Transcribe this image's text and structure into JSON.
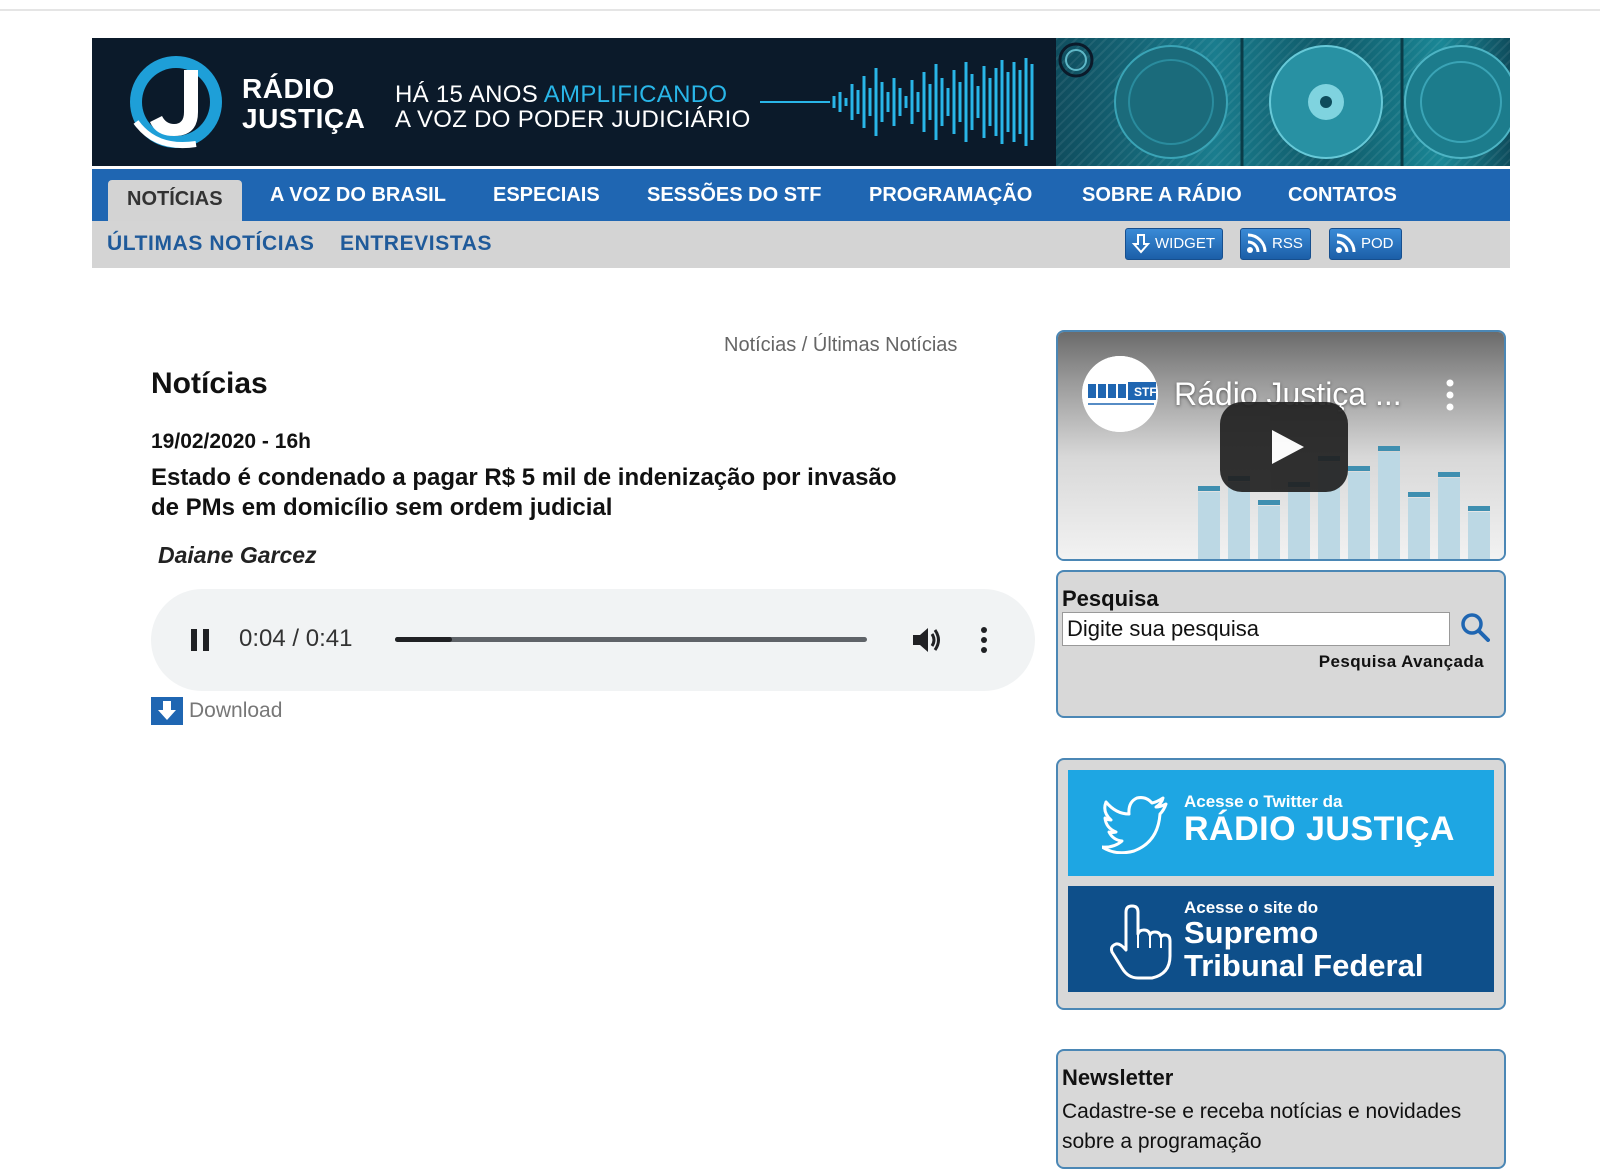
{
  "header": {
    "logo_line1": "RÁDIO",
    "logo_line2": "JUSTIÇA",
    "slogan_pre": "HÁ 15 ANOS ",
    "slogan_accent": "AMPLIFICANDO",
    "slogan_line2": "A VOZ DO PODER JUDICIÁRIO"
  },
  "nav": {
    "items": [
      {
        "label": "NOTÍCIAS",
        "active": true
      },
      {
        "label": "A VOZ DO BRASIL"
      },
      {
        "label": "ESPECIAIS"
      },
      {
        "label": "SESSÕES DO STF"
      },
      {
        "label": "PROGRAMAÇÃO"
      },
      {
        "label": "SOBRE A RÁDIO"
      },
      {
        "label": "CONTATOS"
      }
    ]
  },
  "subnav": {
    "items": [
      "ÚLTIMAS NOTÍCIAS",
      "ENTREVISTAS"
    ],
    "buttons": [
      "WIDGET",
      "RSS",
      "POD"
    ]
  },
  "breadcrumb": {
    "part1": "Notícias",
    "sep": " / ",
    "part2": "Últimas Notícias"
  },
  "article": {
    "section_title": "Notícias",
    "date": "19/02/2020 - 16h",
    "headline": "Estado é condenado a pagar R$ 5 mil de indenização por invasão de PMs em domicílio sem ordem judicial",
    "author": "Daiane Garcez"
  },
  "audio": {
    "time": "0:04 / 0:41",
    "progress": 0.12
  },
  "download": {
    "label": "Download"
  },
  "video": {
    "title": "Rádio Justiça ...",
    "channel_badge": "STF"
  },
  "search": {
    "label": "Pesquisa",
    "placeholder": "Digite sua pesquisa",
    "advanced": "Pesquisa Avançada"
  },
  "promos": {
    "twitter_small": "Acesse o Twitter da",
    "twitter_big": "RÁDIO JUSTIÇA",
    "stf_small": "Acesse o site do",
    "stf_big1": "Supremo",
    "stf_big2": "Tribunal Federal"
  },
  "newsletter": {
    "title": "Newsletter",
    "text": "Cadastre-se e receba notícias e novidades sobre a programação"
  },
  "colors": {
    "nav_blue": "#1f66b2",
    "accent_cyan": "#29b6e8",
    "twitter_blue": "#1ea6e3",
    "stf_blue": "#0e4f8a"
  }
}
